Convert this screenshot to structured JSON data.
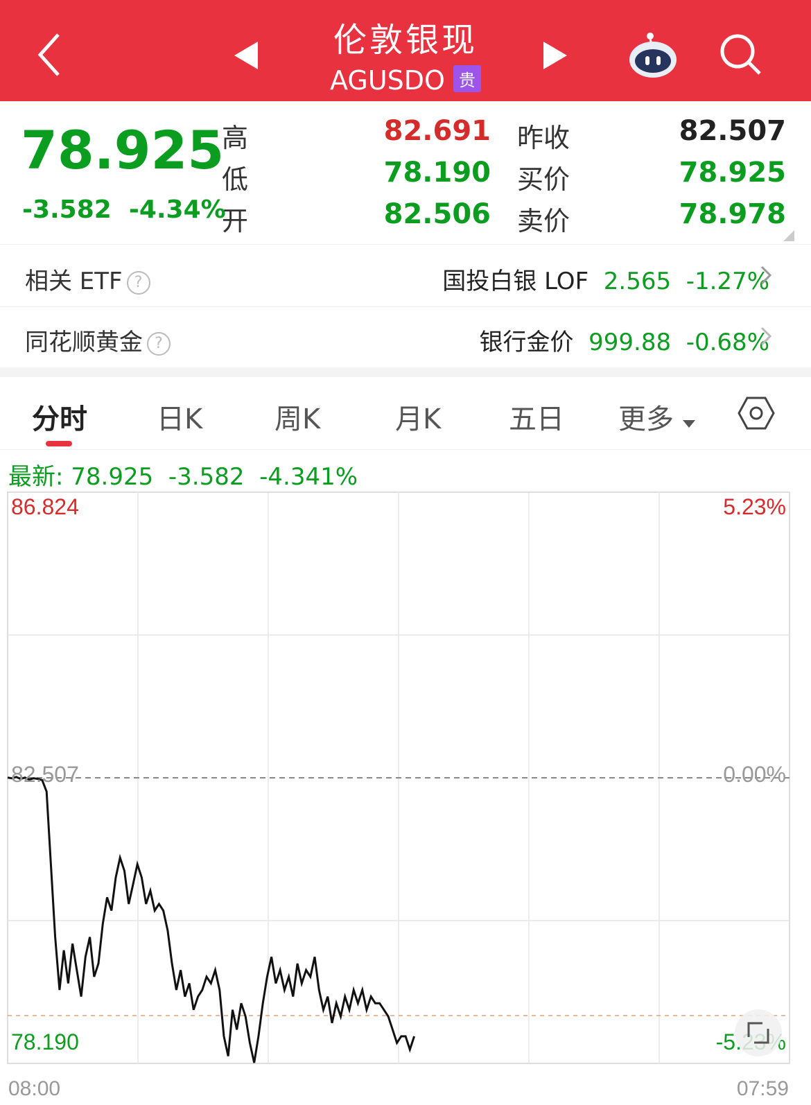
{
  "header": {
    "title": "伦敦银现",
    "code": "AGUSDO",
    "badge": "贵"
  },
  "quote": {
    "price": "78.925",
    "change": "-3.582",
    "change_pct": "-4.34%",
    "high_label": "高",
    "high": "82.691",
    "low_label": "低",
    "low": "78.190",
    "open_label": "开",
    "open": "82.506",
    "prev_close_label": "昨收",
    "prev_close": "82.507",
    "bid_label": "买价",
    "bid": "78.925",
    "ask_label": "卖价",
    "ask": "78.978"
  },
  "etf_row": {
    "label": "相关 ETF",
    "name": "国投白银 LOF",
    "value": "2.565",
    "pct": "-1.27%"
  },
  "gold_row": {
    "label": "同花顺黄金",
    "name": "银行金价",
    "value": "999.88",
    "pct": "-0.68%"
  },
  "tabs": [
    "分时",
    "日K",
    "周K",
    "月K",
    "五日",
    "更多"
  ],
  "latest": {
    "label": "最新:",
    "price": "78.925",
    "change": "-3.582",
    "pct": "-4.341%"
  },
  "chart_data": {
    "type": "line",
    "y_max": "86.824",
    "y_max_pct": "5.23%",
    "y_ref": "82.507",
    "y_ref_pct": "0.00%",
    "y_min": "78.190",
    "y_min_pct": "-5.23%",
    "x_start": "08:00",
    "x_end": "07:59",
    "ylim": [
      78.19,
      86.824
    ],
    "x_fraction_range": [
      0,
      0.52
    ],
    "values": [
      82.51,
      82.5,
      82.52,
      82.49,
      82.51,
      82.48,
      82.5,
      82.49,
      82.47,
      82.3,
      81.2,
      80.1,
      79.3,
      79.9,
      79.4,
      80.0,
      79.6,
      79.2,
      79.8,
      80.1,
      79.5,
      79.7,
      80.3,
      80.7,
      80.5,
      81.0,
      81.3,
      81.1,
      80.6,
      80.9,
      81.2,
      81.0,
      80.6,
      80.8,
      80.5,
      80.6,
      80.5,
      80.2,
      79.7,
      79.3,
      79.6,
      79.2,
      79.4,
      79.0,
      79.2,
      79.3,
      79.5,
      79.4,
      79.6,
      79.3,
      78.6,
      78.3,
      79.0,
      78.7,
      79.1,
      78.9,
      78.5,
      78.2,
      78.6,
      79.1,
      79.5,
      79.8,
      79.4,
      79.6,
      79.3,
      79.5,
      79.2,
      79.7,
      79.4,
      79.6,
      79.5,
      79.8,
      79.3,
      79.0,
      79.2,
      78.8,
      79.1,
      78.9,
      79.2,
      79.0,
      79.3,
      79.1,
      79.3,
      79.0,
      79.2,
      79.1,
      79.1,
      79.0,
      78.9,
      78.7,
      78.5,
      78.6,
      78.6,
      78.4,
      78.6
    ]
  },
  "colors": {
    "header": "#e8323f",
    "up": "#d52b2b",
    "down": "#0a9d1f",
    "badge": "#9d54e8"
  }
}
